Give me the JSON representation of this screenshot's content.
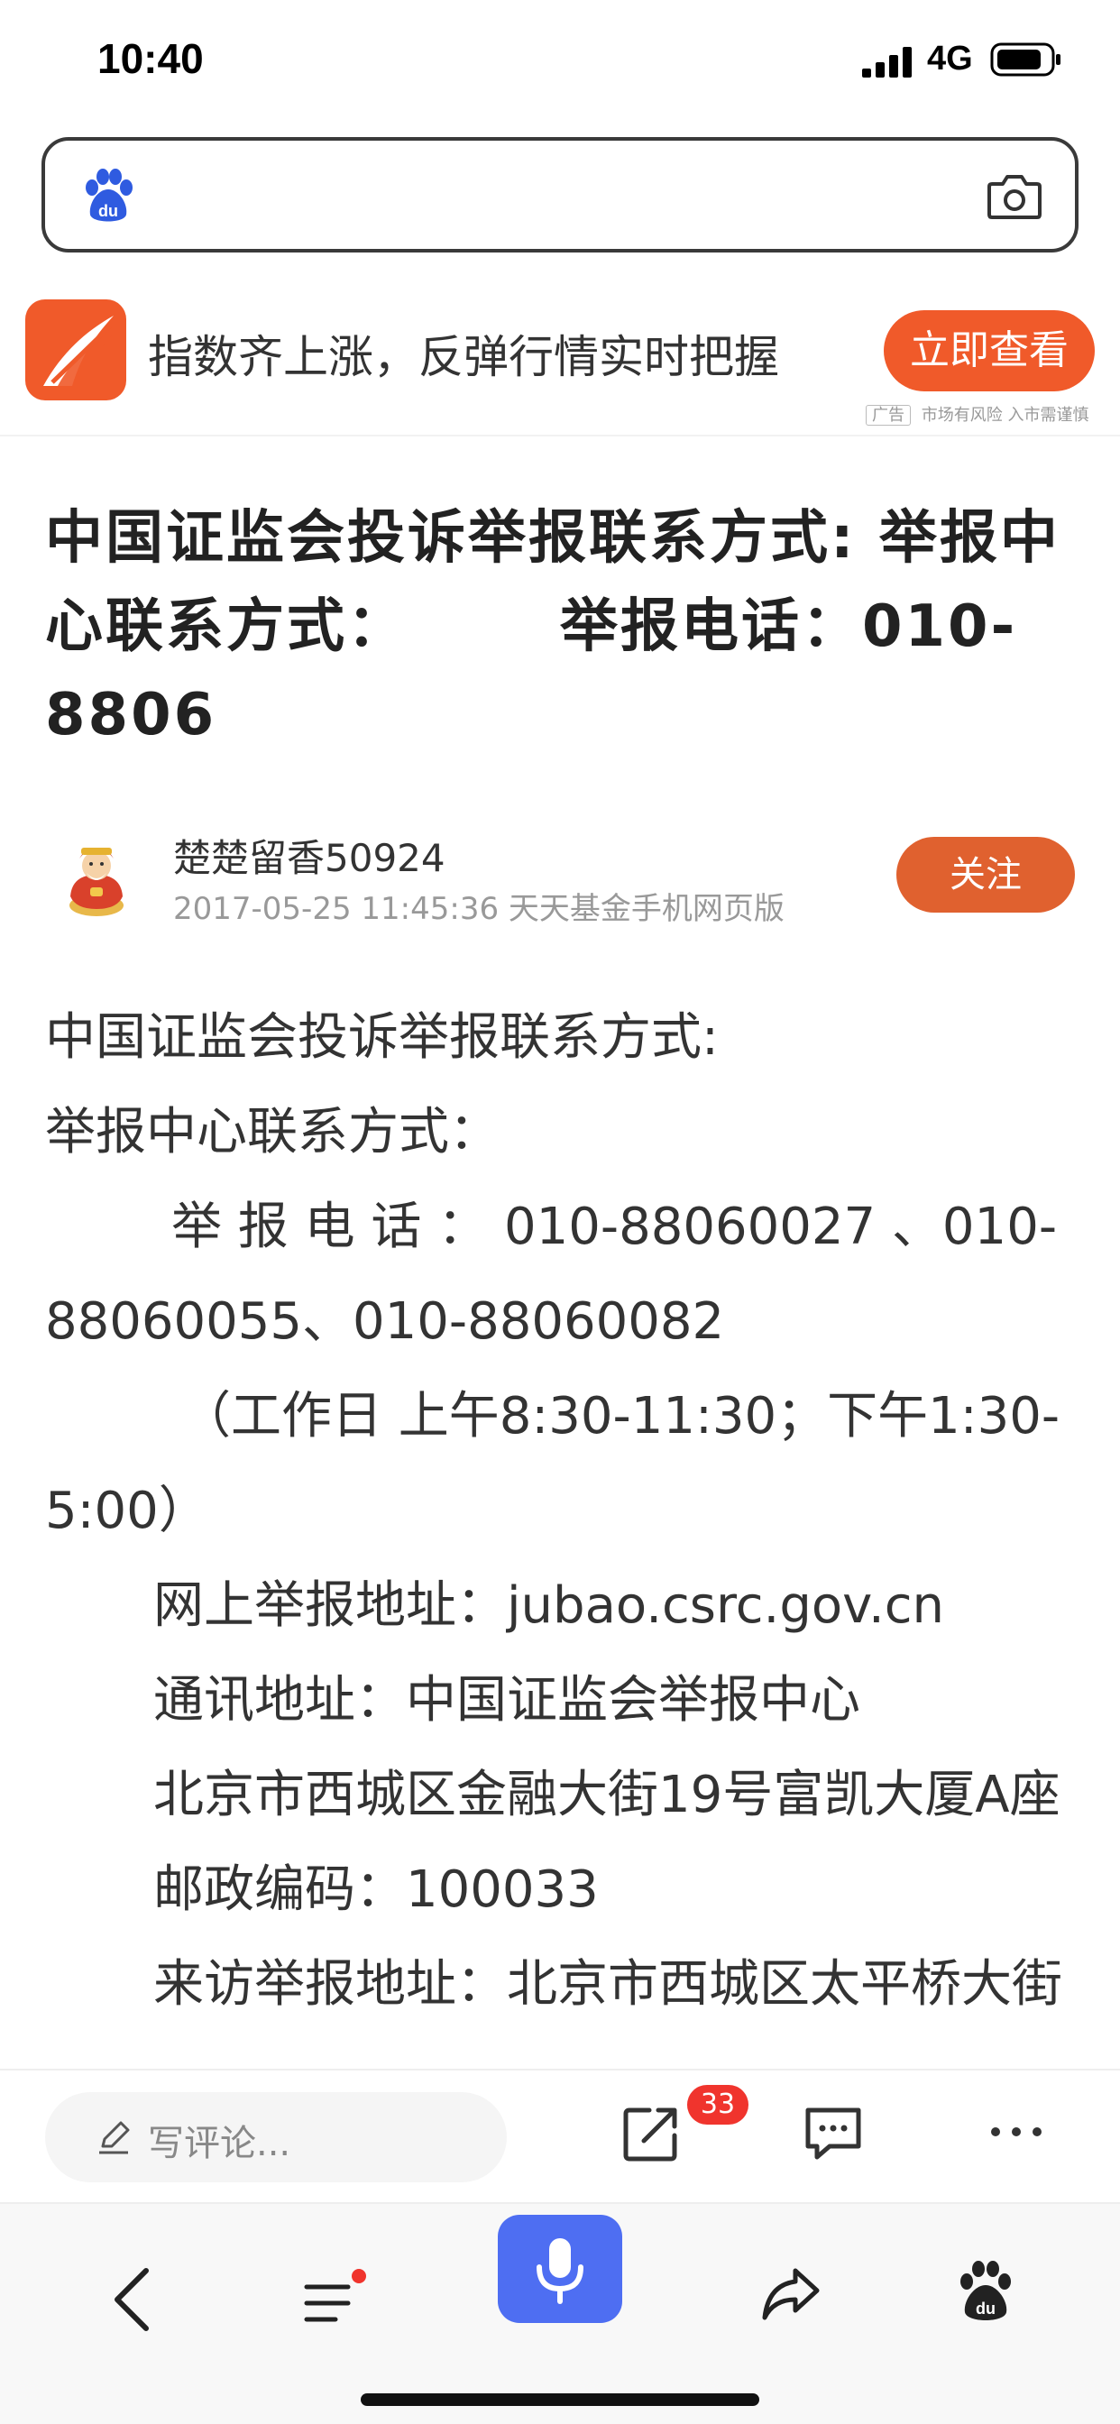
{
  "status_bar": {
    "time": "10:40",
    "network": "4G"
  },
  "search": {
    "logo_icon": "baidu-paw-icon",
    "camera_icon": "camera-icon",
    "value": ""
  },
  "ad": {
    "text": "指数齐上涨，反弹行情实时把握",
    "button_label": "立即查看",
    "tag_label": "广告",
    "disclaimer": "市场有风险 入市需谨慎",
    "brand_color": "#f05a2a"
  },
  "article": {
    "title": "中国证监会投诉举报联系方式: 举报中心联系方式：　　　举报电话：010-8806",
    "author": {
      "name": "楚楚留香50924",
      "meta": "2017-05-25 11:45:36 天天基金手机网页版",
      "follow_label": "关注"
    },
    "paragraphs": [
      "中国证监会投诉举报联系方式:",
      "举报中心联系方式：",
      "举 报 电 话 ： 010-88060027 、010-88060055、010-88060082",
      "（工作日 上午8:30-11:30；下午1:30-5:00）",
      "网上举报地址：jubao.csrc.gov.cn",
      "通讯地址：中国证监会举报中心",
      "北京市西城区金融大街19号富凯大厦A座",
      "邮政编码：100033",
      "来访举报地址：北京市西城区太平桥大街"
    ]
  },
  "comment_bar": {
    "placeholder": "写评论...",
    "share_count": "33"
  },
  "bottom_nav": {
    "accent_color": "#4e6ef2",
    "items": [
      "back-icon",
      "menu-icon",
      "microphone-icon",
      "share-icon",
      "baidu-icon"
    ]
  }
}
